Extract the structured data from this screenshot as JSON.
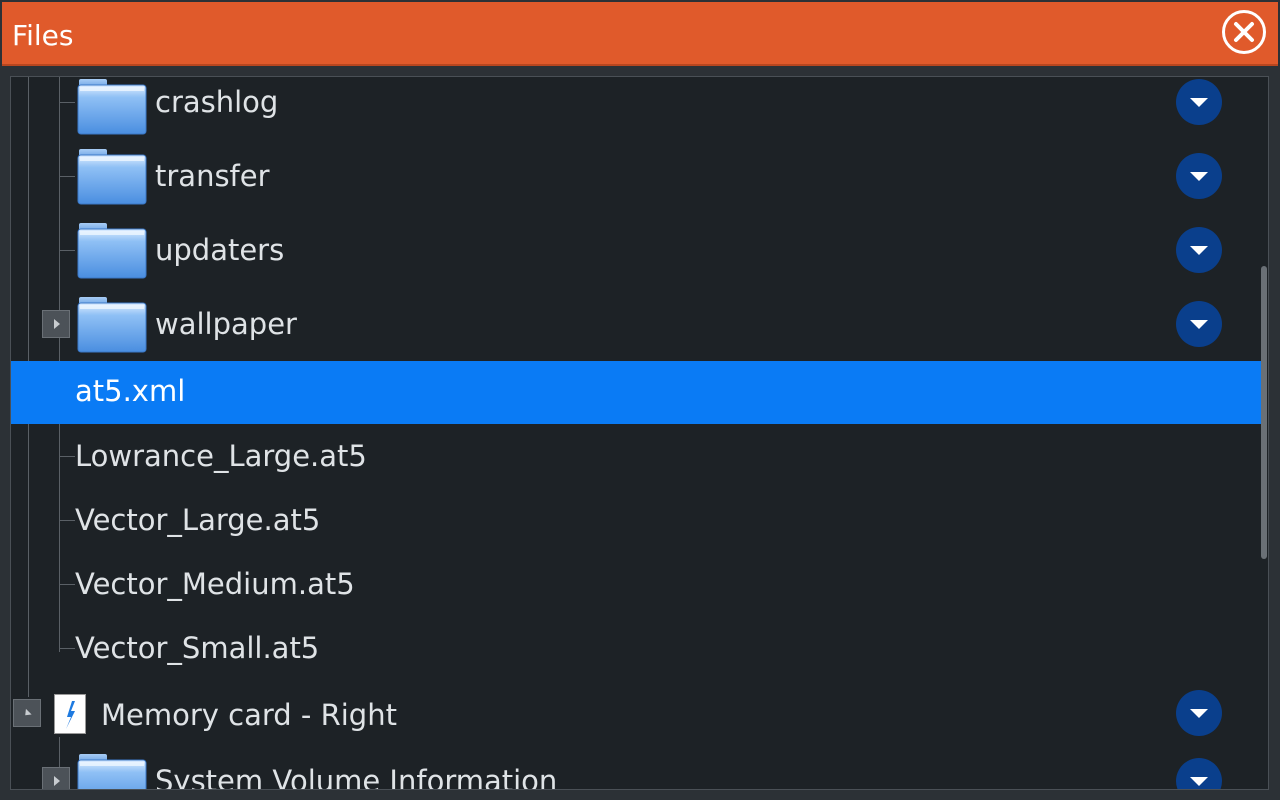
{
  "window": {
    "title": "Files"
  },
  "tree": {
    "items": [
      {
        "label": "crashlog",
        "type": "folder"
      },
      {
        "label": "transfer",
        "type": "folder"
      },
      {
        "label": "updaters",
        "type": "folder"
      },
      {
        "label": "wallpaper",
        "type": "folder",
        "collapsed": true
      },
      {
        "label": "at5.xml",
        "type": "file",
        "selected": true
      },
      {
        "label": "Lowrance_Large.at5",
        "type": "file"
      },
      {
        "label": "Vector_Large.at5",
        "type": "file"
      },
      {
        "label": "Vector_Medium.at5",
        "type": "file"
      },
      {
        "label": "Vector_Small.at5",
        "type": "file"
      },
      {
        "label": "Memory card - Right",
        "type": "drive",
        "expanded": true
      },
      {
        "label": "System Volume Information",
        "type": "folder",
        "collapsed": true
      }
    ]
  },
  "colors": {
    "titlebar": "#e05a2b",
    "selection": "#0a7bf5",
    "menu_button": "#0a3f8c"
  }
}
